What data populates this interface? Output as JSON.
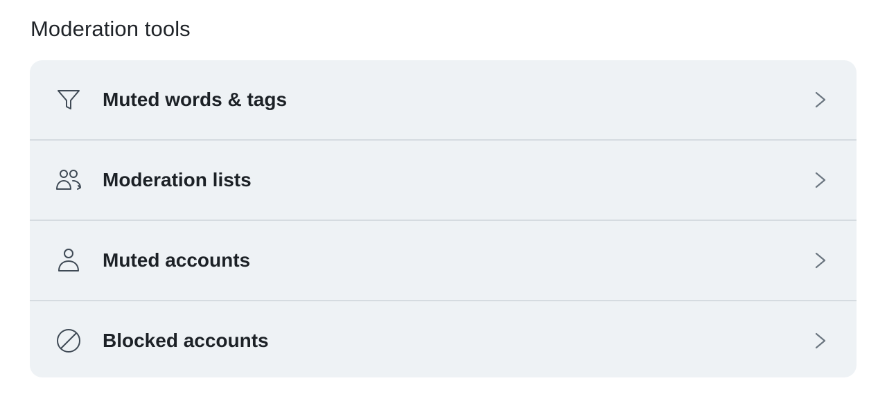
{
  "section": {
    "title": "Moderation tools"
  },
  "items": [
    {
      "label": "Muted words & tags",
      "icon": "filter-icon"
    },
    {
      "label": "Moderation lists",
      "icon": "people-icon"
    },
    {
      "label": "Muted accounts",
      "icon": "person-icon"
    },
    {
      "label": "Blocked accounts",
      "icon": "block-icon"
    }
  ],
  "colors": {
    "card_background": "#eef2f5",
    "divider": "#d5dbe0",
    "text": "#1c2126",
    "icon": "#3f4a55",
    "chevron": "#6b7680"
  }
}
